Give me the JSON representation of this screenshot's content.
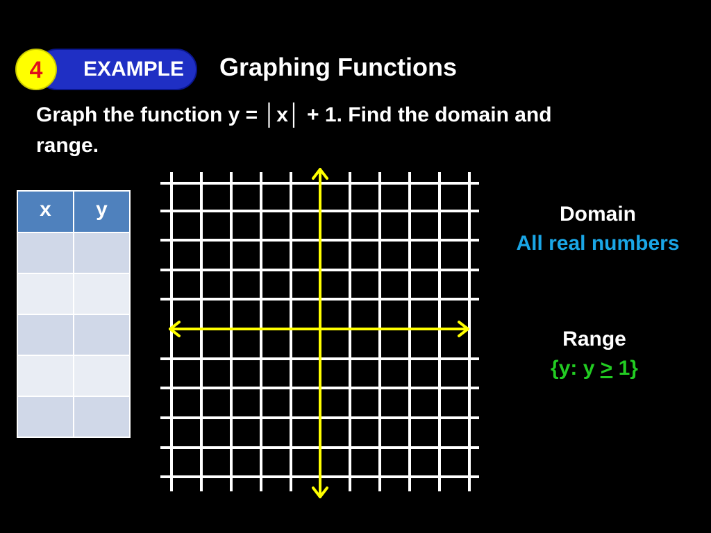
{
  "badge": {
    "number": "4",
    "label": "EXAMPLE"
  },
  "title": "Graphing Functions",
  "prompt": {
    "line1": "Graph the function y = │x│ + 1.  Find the domain and",
    "line2": "range."
  },
  "table": {
    "headers": [
      "x",
      "y"
    ],
    "rows": [
      [
        "",
        ""
      ],
      [
        "",
        ""
      ],
      [
        "",
        ""
      ],
      [
        "",
        ""
      ],
      [
        "",
        ""
      ]
    ]
  },
  "domain": {
    "label": "Domain",
    "value": "All real numbers"
  },
  "range": {
    "label": "Range",
    "value_prefix": "{y: y ",
    "value_symbol": ">",
    "value_suffix": " 1}"
  },
  "colors": {
    "background": "#000000",
    "grid": "#ffffff",
    "axes": "#ffff00",
    "badge_circle": "#ffff00",
    "badge_number": "#e0101c",
    "badge_pill": "#1f2fc4",
    "table_header": "#4f81bd",
    "domain_value": "#1aa6e6",
    "range_value": "#22cc22"
  },
  "icons": {
    "axis_arrow": "arrowhead-icon"
  }
}
